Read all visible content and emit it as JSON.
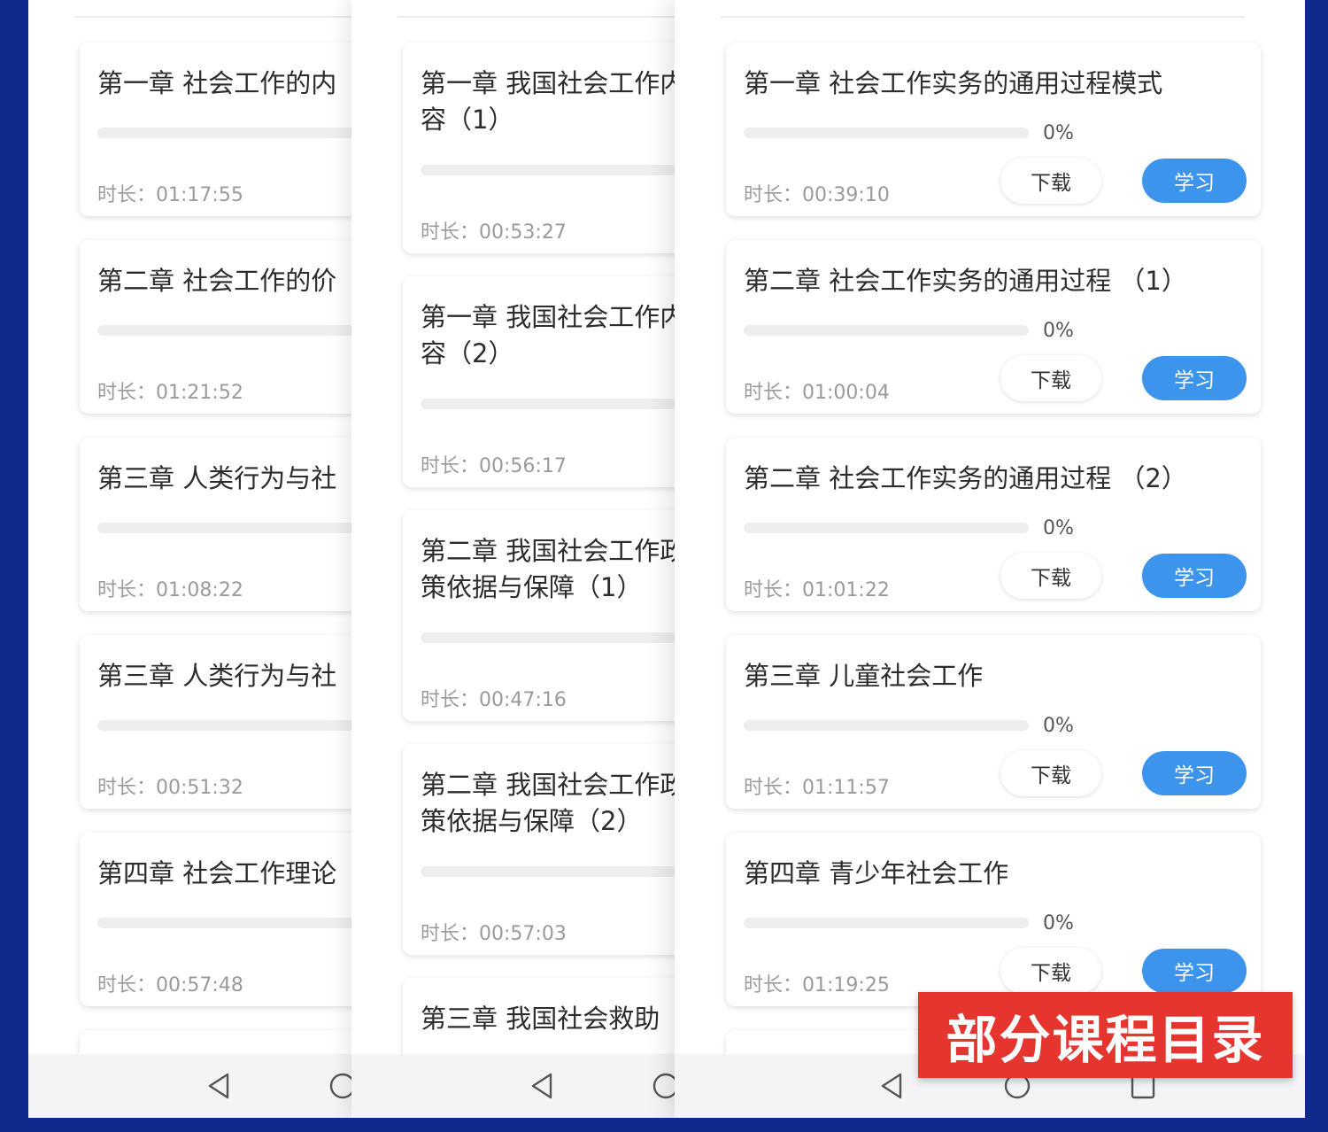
{
  "labels": {
    "duration_prefix": "时长：",
    "download": "下载",
    "study": "学习"
  },
  "panel1": {
    "lessons": [
      {
        "title": "第一章 社会工作的内",
        "duration": "01:17:55"
      },
      {
        "title": "第二章 社会工作的价",
        "duration": "01:21:52"
      },
      {
        "title": "第三章 人类行为与社",
        "duration": "01:08:22"
      },
      {
        "title": "第三章 人类行为与社",
        "duration": "00:51:32"
      },
      {
        "title": "第四章 社会工作理论",
        "duration": "00:57:48"
      }
    ]
  },
  "panel2": {
    "lessons": [
      {
        "title": "第一章 我国社会工作内容（1）",
        "duration": "00:53:27"
      },
      {
        "title": "第一章 我国社会工作内容（2）",
        "duration": "00:56:17"
      },
      {
        "title": "第二章 我国社会工作政策依据与保障（1）",
        "duration": "00:47:16"
      },
      {
        "title": "第二章 我国社会工作政策依据与保障（2）",
        "duration": "00:57:03"
      },
      {
        "title": "第三章 我国社会救助",
        "duration": ""
      }
    ]
  },
  "panel3": {
    "lessons": [
      {
        "title": "第一章 社会工作实务的通用过程模式",
        "progress": "0%",
        "progress_value": 0,
        "duration": "00:39:10"
      },
      {
        "title": "第二章 社会工作实务的通用过程 （1）",
        "progress": "0%",
        "progress_value": 0,
        "duration": "01:00:04"
      },
      {
        "title": "第二章 社会工作实务的通用过程 （2）",
        "progress": "0%",
        "progress_value": 0,
        "duration": "01:01:22"
      },
      {
        "title": "第三章 儿童社会工作",
        "progress": "0%",
        "progress_value": 0,
        "duration": "01:11:57"
      },
      {
        "title": "第四章 青少年社会工作",
        "progress": "0%",
        "progress_value": 0,
        "duration": "01:19:25"
      }
    ]
  },
  "banner": {
    "text": "部分课程目录"
  },
  "colors": {
    "background": "#0e2a8c",
    "accent": "#3d94ec",
    "banner": "#e6352e"
  },
  "nav_icons": [
    "back-icon",
    "home-icon",
    "recents-icon"
  ]
}
